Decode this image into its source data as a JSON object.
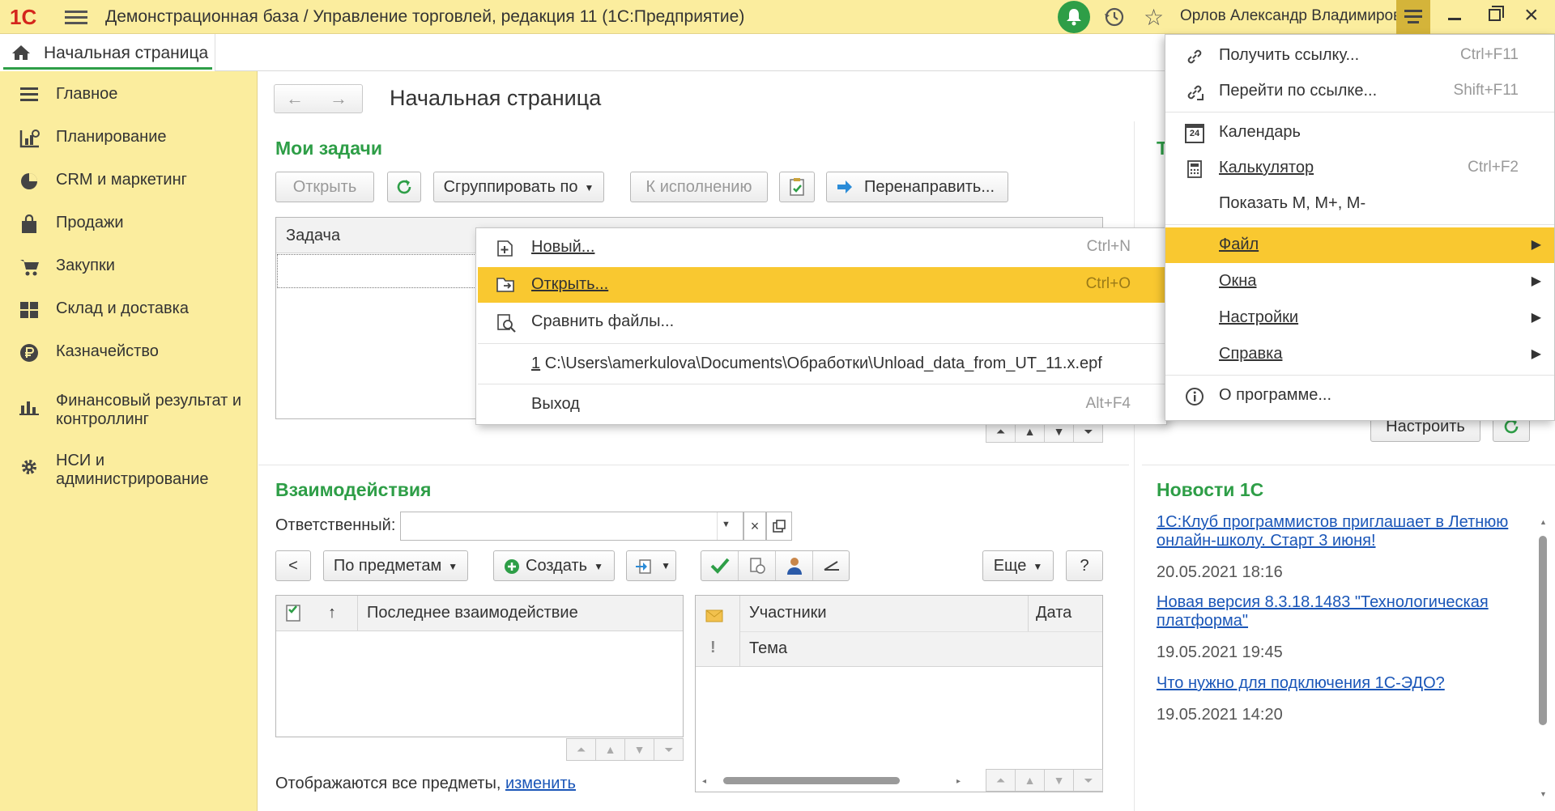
{
  "titlebar": {
    "logo": "1С",
    "title": "Демонстрационная база / Управление торговлей, редакция 11  (1С:Предприятие)",
    "user": "Орлов Александр Владимирович"
  },
  "tabs": {
    "home": "Начальная страница"
  },
  "sidebar": {
    "items": [
      {
        "label": "Главное",
        "icon": "menu-lines-icon"
      },
      {
        "label": "Планирование",
        "icon": "planning-icon"
      },
      {
        "label": "CRM и маркетинг",
        "icon": "pie-chart-icon"
      },
      {
        "label": "Продажи",
        "icon": "shopping-bag-icon"
      },
      {
        "label": "Закупки",
        "icon": "cart-icon"
      },
      {
        "label": "Склад и доставка",
        "icon": "warehouse-icon"
      },
      {
        "label": "Казначейство",
        "icon": "ruble-icon"
      },
      {
        "label": "Финансовый результат и контроллинг",
        "icon": "bar-chart-icon"
      },
      {
        "label": "НСИ и администрирование",
        "icon": "gear-icon"
      }
    ]
  },
  "page": {
    "title": "Начальная страница"
  },
  "tasks": {
    "title": "Мои задачи",
    "open": "Открыть",
    "group_by": "Сгруппировать по",
    "to_exec": "К исполнению",
    "redirect": "Перенаправить...",
    "column": "Задача"
  },
  "right_panel": {
    "title_partial": "Т",
    "configure": "Настроить"
  },
  "interactions": {
    "title": "Взаимодействия",
    "responsible_label": "Ответственный:",
    "responsible_value": "",
    "by_subjects": "По предметам",
    "create": "Создать",
    "more": "Еще",
    "help": "?",
    "col_arrow": "↑",
    "col_last": "Последнее взаимодействие",
    "col_participants": "Участники",
    "col_date": "Дата",
    "col_topic": "Тема",
    "footer_text": "Отображаются все предметы,",
    "footer_link": "изменить"
  },
  "news": {
    "title": "Новости 1С",
    "items": [
      {
        "text": "1С:Клуб программистов приглашает в Летнюю онлайн-школу. Старт 3 июня!",
        "date": "20.05.2021 18:16"
      },
      {
        "text": "Новая версия 8.3.18.1483 \"Технологическая платформа\"",
        "date": "19.05.2021 19:45"
      },
      {
        "text": "Что нужно для подключения 1С-ЭДО?",
        "date": "19.05.2021 14:20"
      }
    ]
  },
  "file_menu": {
    "new": "Новый...",
    "new_sc": "Ctrl+N",
    "open": "Открыть...",
    "open_sc": "Ctrl+O",
    "compare": "Сравнить файлы...",
    "recent_num": "1",
    "recent_path": "C:\\Users\\amerkulova\\Documents\\Обработки\\Unload_data_from_UT_11.x.epf",
    "exit": "Выход",
    "exit_sc": "Alt+F4"
  },
  "main_menu": {
    "get_link": "Получить ссылку...",
    "get_link_sc": "Ctrl+F11",
    "goto_link": "Перейти по ссылке...",
    "goto_link_sc": "Shift+F11",
    "calendar": "Календарь",
    "calendar_num": "24",
    "calculator": "Калькулятор",
    "calculator_sc": "Ctrl+F2",
    "show_m": "Показать M, M+, M-",
    "file": "Файл",
    "windows": "Окна",
    "settings": "Настройки",
    "help": "Справка",
    "about": "О программе..."
  },
  "colors": {
    "accent_green": "#2e9e47",
    "panel_yellow": "#fbed9e",
    "highlight": "#f9c830",
    "link_blue": "#1a56b8"
  }
}
